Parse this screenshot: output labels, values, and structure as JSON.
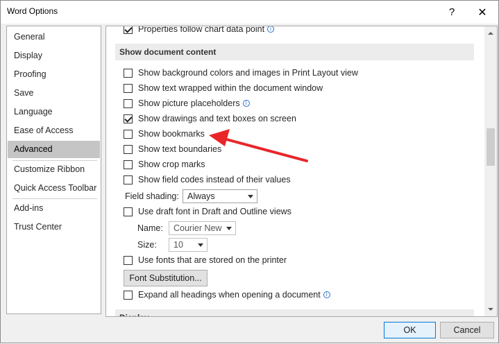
{
  "window": {
    "title": "Word Options",
    "help_glyph": "?",
    "close_glyph": "✕"
  },
  "nav": {
    "items": [
      {
        "label": "General"
      },
      {
        "label": "Display"
      },
      {
        "label": "Proofing"
      },
      {
        "label": "Save"
      },
      {
        "label": "Language"
      },
      {
        "label": "Ease of Access"
      },
      {
        "label": "Advanced",
        "selected": true
      },
      {
        "label": "Customize Ribbon"
      },
      {
        "label": "Quick Access Toolbar"
      },
      {
        "label": "Add-ins"
      },
      {
        "label": "Trust Center"
      }
    ]
  },
  "content": {
    "partial_top_option": "Properties follow chart data point",
    "section_title": "Show document content",
    "options": [
      {
        "label": "Show background colors and images in Print Layout view",
        "checked": false
      },
      {
        "label": "Show text wrapped within the document window",
        "checked": false
      },
      {
        "label": "Show picture placeholders",
        "checked": false
      },
      {
        "label": "Show drawings and text boxes on screen",
        "checked": true
      },
      {
        "label": "Show bookmarks",
        "checked": false
      },
      {
        "label": "Show text boundaries",
        "checked": false
      },
      {
        "label": "Show crop marks",
        "checked": false
      },
      {
        "label": "Show field codes instead of their values",
        "checked": false
      }
    ],
    "field_shading": {
      "label": "Field shading:",
      "value": "Always"
    },
    "draft_font": {
      "label": "Use draft font in Draft and Outline views",
      "checked": false
    },
    "name": {
      "label": "Name:",
      "value": "Courier New"
    },
    "size": {
      "label": "Size:",
      "value": "10"
    },
    "printer_fonts": {
      "label": "Use fonts that are stored on the printer",
      "checked": false
    },
    "font_substitution_button": "Font Substitution...",
    "expand_headings": {
      "label": "Expand all headings when opening a document",
      "checked": false
    },
    "next_section_title": "Display"
  },
  "footer": {
    "ok_label": "OK",
    "cancel_label": "Cancel"
  },
  "colors": {
    "annotation_arrow": "#e8262a",
    "info_icon": "#2a6fc9",
    "selected_nav": "#c5c5c5"
  },
  "icons": {
    "info": "info-icon",
    "check": "checkmark-icon"
  }
}
